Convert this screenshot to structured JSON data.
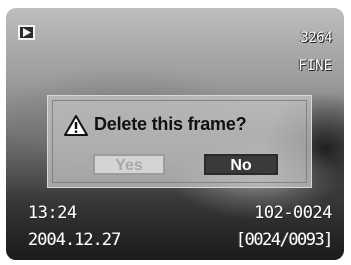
{
  "header": {
    "mode_icon": "playback-icon",
    "frames_remaining": "3264",
    "image_quality": "FINE"
  },
  "dialog": {
    "icon": "warning-icon",
    "message": "Delete this frame?",
    "yes_label": "Yes",
    "no_label": "No",
    "selected": "No"
  },
  "footer": {
    "time": "13:24",
    "date": "2004.12.27",
    "file_number": "102-0024",
    "frame_counter": "[0024/0093]"
  },
  "colors": {
    "selected_button": "#3a3a3a",
    "unselected_button": "#d4d4d4",
    "osd_text": "#ffffff"
  }
}
